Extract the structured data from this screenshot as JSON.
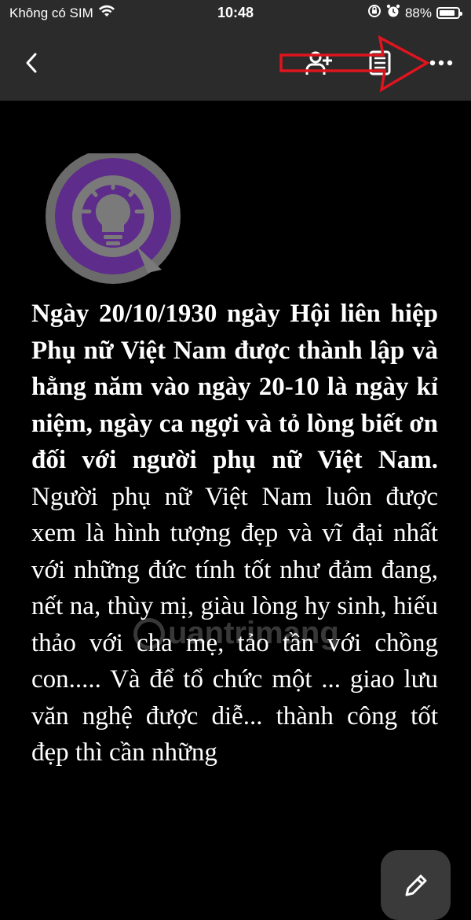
{
  "status_bar": {
    "carrier": "Không có SIM",
    "time": "10:48",
    "battery_percent": "88%",
    "battery_level": 0.88
  },
  "toolbar": {
    "icons": [
      "back-icon",
      "add-person-icon",
      "notes-icon",
      "more-icon"
    ]
  },
  "article": {
    "lead": "Ngày 20/10/1930 ngày Hội liên hiệp Phụ nữ Việt Nam được thành lập và hằng năm vào ngày 20-10 là ngày kỉ niệm, ngày ca ngợi và tỏ lòng biết ơn đối với người phụ nữ Việt Nam.",
    "body": "Người phụ nữ Việt Nam luôn được xem là hình tượng đẹp và vĩ đại nhất với những đức tính tốt như đảm đang, nết na, thùy mị, giàu lòng hy sinh, hiếu thảo với cha mẹ, tảo tần với chồng con..... Và để tổ chức một ... giao lưu văn nghệ được diễ... thành công tốt đẹp thì cần những"
  },
  "watermark": "uantrimang",
  "colors": {
    "bar_bg": "#2b2b2b",
    "page_bg": "#000000",
    "logo_purple": "#5e2c8a",
    "annotation_red": "#e0141e"
  }
}
